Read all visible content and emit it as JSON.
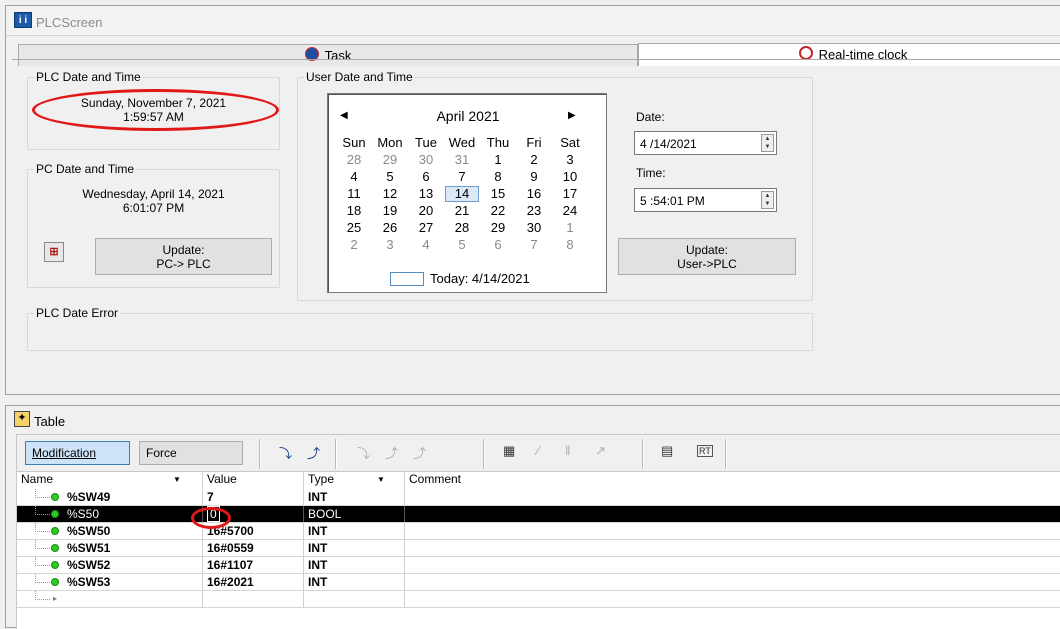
{
  "window_top": {
    "title": "PLCScreen",
    "tabs": [
      {
        "label": "Task",
        "active": false
      },
      {
        "label": "Real-time clock",
        "active": true
      }
    ]
  },
  "plc_datetime": {
    "label": "PLC Date and Time",
    "date": "Sunday, November 7, 2021",
    "time": "1:59:57 AM"
  },
  "pc_datetime": {
    "label": "PC Date and Time",
    "date": "Wednesday, April 14, 2021",
    "time": "6:01:07 PM",
    "update_button": {
      "line1": "Update:",
      "line2": "PC-> PLC"
    }
  },
  "user_datetime": {
    "label": "User Date and Time",
    "calendar": {
      "month": "April 2021",
      "weekdays": [
        "Sun",
        "Mon",
        "Tue",
        "Wed",
        "Thu",
        "Fri",
        "Sat"
      ],
      "weeks": [
        [
          "28",
          "29",
          "30",
          "31",
          "1",
          "2",
          "3"
        ],
        [
          "4",
          "5",
          "6",
          "7",
          "8",
          "9",
          "10"
        ],
        [
          "11",
          "12",
          "13",
          "14",
          "15",
          "16",
          "17"
        ],
        [
          "18",
          "19",
          "20",
          "21",
          "22",
          "23",
          "24"
        ],
        [
          "25",
          "26",
          "27",
          "28",
          "29",
          "30",
          "1"
        ],
        [
          "2",
          "3",
          "4",
          "5",
          "6",
          "7",
          "8"
        ]
      ],
      "selected_day": "14",
      "today_label": "Today: 4/14/2021"
    },
    "date_label": "Date:",
    "date_value": "4 /14/2021",
    "time_label": "Time:",
    "time_value": "5 :54:01 PM",
    "update_button": {
      "line1": "Update:",
      "line2": "User->PLC"
    }
  },
  "plc_date_error": {
    "label": "PLC Date Error"
  },
  "table_window": {
    "title": "Table",
    "toolbar": {
      "modification": "Modification",
      "force": "Force"
    },
    "columns": {
      "name": "Name",
      "value": "Value",
      "type": "Type",
      "comment": "Comment"
    },
    "rows": [
      {
        "name": "%SW49",
        "value": "7",
        "type": "INT",
        "comment": ""
      },
      {
        "name": "%S50",
        "value": "0",
        "type": "BOOL",
        "comment": ""
      },
      {
        "name": "%SW50",
        "value": "16#5700",
        "type": "INT",
        "comment": ""
      },
      {
        "name": "%SW51",
        "value": "16#0559",
        "type": "INT",
        "comment": ""
      },
      {
        "name": "%SW52",
        "value": "16#1107",
        "type": "INT",
        "comment": ""
      },
      {
        "name": "%SW53",
        "value": "16#2021",
        "type": "INT",
        "comment": ""
      }
    ],
    "selected_row": 1
  },
  "colors": {
    "highlight": "#e01818",
    "selection": "#000000",
    "status_dot": "#2ecc22"
  }
}
